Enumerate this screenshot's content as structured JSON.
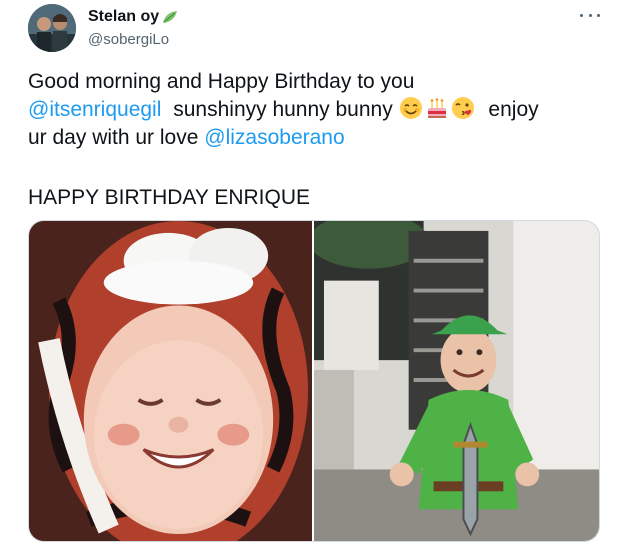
{
  "author": {
    "name": "Stelan oy",
    "handle": "@sobergiLo",
    "avatar_icon": "avatar-photo",
    "badge_icon": "leaf-emoji-icon"
  },
  "tweet": {
    "line1": "Good morning and Happy Birthday to you",
    "mention1": "@itsenriquegil",
    "line2_text": "sunshinyy hunny bunny",
    "emojis": [
      "smiling-face-icon",
      "birthday-cake-icon",
      "face-blowing-kiss-icon"
    ],
    "line2_tail": "enjoy",
    "line3_text": "ur day with ur love",
    "mention2": "@lizasoberano",
    "headline": "HAPPY BIRTHDAY ENRIQUE"
  },
  "media": {
    "photos": [
      "child-tiger-costume-photo",
      "child-peter-pan-costume-photo"
    ]
  },
  "colors": {
    "link": "#1d9bf0",
    "text": "#0f1419",
    "muted": "#536471",
    "border": "#cfd9de"
  },
  "menu_icon": "more-options-icon"
}
